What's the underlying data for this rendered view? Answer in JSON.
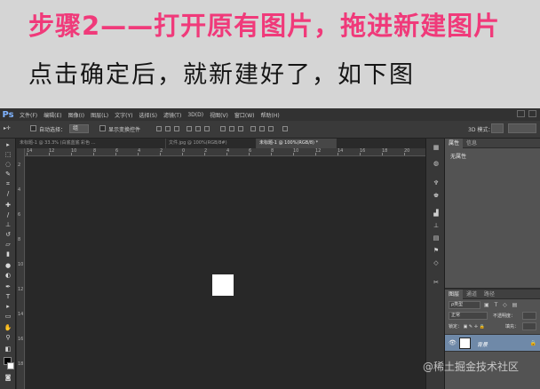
{
  "banner": {
    "step": "步骤2——打开原有图片，拖进新建图片",
    "desc": "点击确定后，就新建好了，如下图",
    "step_color": "#f03a7a"
  },
  "ps": {
    "logo": "Ps",
    "menu": [
      "文件(F)",
      "编辑(E)",
      "图像(I)",
      "图层(L)",
      "文字(Y)",
      "选择(S)",
      "滤镜(T)",
      "3D(D)",
      "视图(V)",
      "窗口(W)",
      "帮助(H)"
    ],
    "options": {
      "auto_select": "自动选择：",
      "auto_select_value": "组",
      "show_transform": "显示变换控件",
      "mode_3d": "3D 模式："
    },
    "tabs": [
      "未标题-1 @ 33.3% (白底蓝底 彩色 ...",
      "文件.jpg @ 100%(RGB/8#)",
      "未标题-1 @ 100%(RGB/8) *"
    ],
    "ruler_h": [
      "14",
      "12",
      "10",
      "8",
      "6",
      "4",
      "2",
      "0",
      "2",
      "4",
      "6",
      "8",
      "10",
      "12",
      "14",
      "16",
      "18",
      "20"
    ],
    "ruler_v": [
      "2",
      "4",
      "6",
      "8",
      "10",
      "12",
      "14",
      "16",
      "18"
    ]
  },
  "properties": {
    "tabs": [
      "属性",
      "信息"
    ],
    "content": "无属性"
  },
  "layers": {
    "tabs": [
      "图层",
      "通道",
      "路径"
    ],
    "kind": "ρ类型",
    "filters": "▣ T ◇ ▤",
    "blend": "正常",
    "opacity_label": "不透明度：",
    "lock_label": "锁定：",
    "fill_label": "填充：",
    "layer_name": "背景",
    "selected_color": "#6f89a8"
  },
  "watermark": "@稀土掘金技术社区"
}
